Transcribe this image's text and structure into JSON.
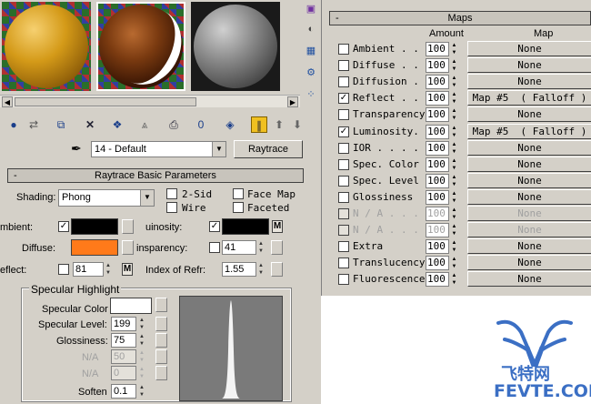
{
  "slots": {
    "count": 3,
    "selected_index": 1
  },
  "material": {
    "name": "14 - Default",
    "type_button": "Raytrace"
  },
  "basic_params": {
    "title": "Raytrace Basic Parameters",
    "shading_label": "Shading:",
    "shading_value": "Phong",
    "two_sided": "2-Sid",
    "wire": "Wire",
    "face_map": "Face Map",
    "faceted": "Faceted",
    "ambient_label": "mbient:",
    "diffuse_label": "Diffuse:",
    "reflect_label": "eflect:",
    "reflect_value": "81",
    "luminosity_label": "uinosity:",
    "transparency_label": "insparency:",
    "transparency_value": "41",
    "ior_label": "Index of Refr:",
    "ior_value": "1.55",
    "m_label": "M",
    "colors": {
      "ambient": "#000000",
      "diffuse": "#ff7a1a",
      "luminosity": "#000000"
    }
  },
  "specular": {
    "group_title": "Specular Highlight",
    "color_label": "Specular Color",
    "level_label": "Specular Level:",
    "level_value": "199",
    "gloss_label": "Glossiness:",
    "gloss_value": "75",
    "na1_label": "N/A",
    "na1_value": "50",
    "na2_label": "N/A",
    "na2_value": "0",
    "soften_label": "Soften",
    "soften_value": "0.1",
    "color": "#ffffff"
  },
  "maps": {
    "title": "Maps",
    "col_amount": "Amount",
    "col_map": "Map",
    "rows": [
      {
        "name": "Ambient . .",
        "amount": "100",
        "map": "None",
        "checked": false,
        "enabled": true
      },
      {
        "name": "Diffuse . .",
        "amount": "100",
        "map": "None",
        "checked": false,
        "enabled": true
      },
      {
        "name": "Diffusion . .",
        "amount": "100",
        "map": "None",
        "checked": false,
        "enabled": true
      },
      {
        "name": "Reflect . .",
        "amount": "100",
        "map": "Map #5  ( Falloff )",
        "checked": true,
        "enabled": true
      },
      {
        "name": "Transparency",
        "amount": "100",
        "map": "None",
        "checked": false,
        "enabled": true
      },
      {
        "name": "Luminosity.",
        "amount": "100",
        "map": "Map #5  ( Falloff )",
        "checked": true,
        "enabled": true
      },
      {
        "name": "IOR . . . . .",
        "amount": "100",
        "map": "None",
        "checked": false,
        "enabled": true
      },
      {
        "name": "Spec. Color",
        "amount": "100",
        "map": "None",
        "checked": false,
        "enabled": true
      },
      {
        "name": "Spec. Level",
        "amount": "100",
        "map": "None",
        "checked": false,
        "enabled": true
      },
      {
        "name": "Glossiness",
        "amount": "100",
        "map": "None",
        "checked": false,
        "enabled": true
      },
      {
        "name": "N / A . . .",
        "amount": "100",
        "map": "None",
        "checked": false,
        "enabled": false
      },
      {
        "name": "N / A . . .",
        "amount": "100",
        "map": "None",
        "checked": false,
        "enabled": false
      },
      {
        "name": "Extra",
        "amount": "100",
        "map": "None",
        "checked": false,
        "enabled": true
      },
      {
        "name": "Translucency",
        "amount": "100",
        "map": "None",
        "checked": false,
        "enabled": true
      },
      {
        "name": "Fluorescence",
        "amount": "100",
        "map": "None",
        "checked": false,
        "enabled": true
      }
    ]
  },
  "watermark": {
    "cn_text": "飞特网",
    "en_text": "FEVTE.COM",
    "color": "#3b6fc4"
  }
}
